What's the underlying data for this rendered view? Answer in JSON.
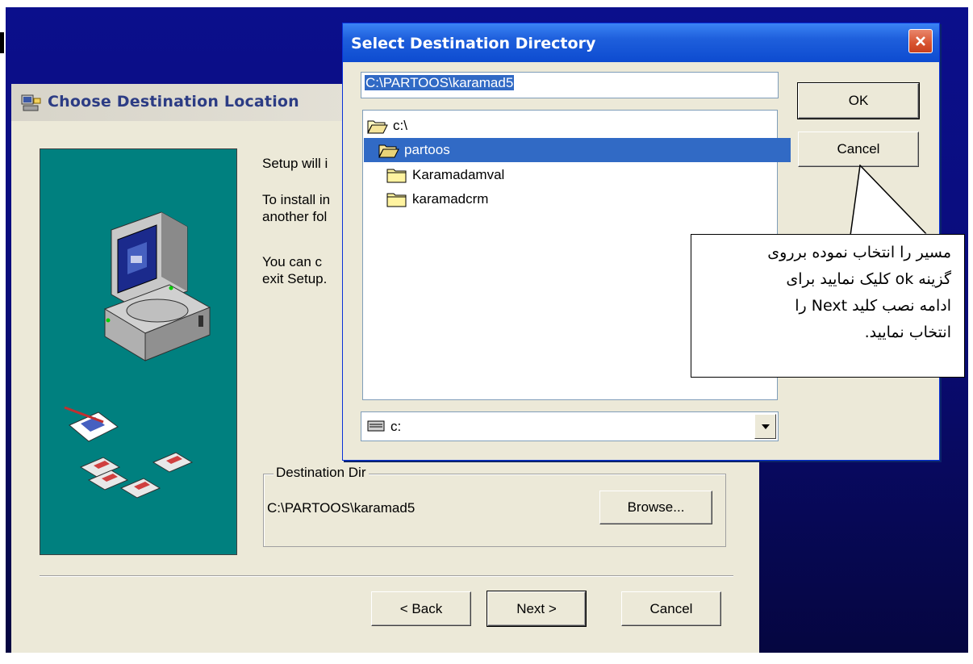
{
  "setup_window": {
    "title": "Choose Destination Location",
    "intro_line": "Setup will i",
    "para2_line1": "To install in",
    "para2_line2": "another fol",
    "para3_line1": "You can c",
    "para3_line2": "exit Setup.",
    "destination_group": {
      "label": "Destination Dir",
      "path": "C:\\PARTOOS\\karamad5",
      "browse_label": "Browse..."
    },
    "buttons": {
      "back": "< Back",
      "next": "Next >",
      "cancel": "Cancel"
    }
  },
  "select_dialog": {
    "title": "Select Destination Directory",
    "path_value": "C:\\PARTOOS\\karamad5",
    "ok_label": "OK",
    "cancel_label": "Cancel",
    "folders": [
      {
        "name": "c:\\",
        "state": "open"
      },
      {
        "name": "partoos",
        "state": "open-selected"
      },
      {
        "name": "Karamadamval",
        "state": "closed"
      },
      {
        "name": "karamadcrm",
        "state": "closed"
      }
    ],
    "drive": "c:"
  },
  "callout": {
    "line1": "مسیر را انتخاب نموده برروی",
    "line2": "گزینه ok کلیک نمایید برای",
    "line3": "ادامه نصب کلید Next را",
    "line4": "انتخاب نمایید."
  },
  "colors": {
    "desktop": "#0a0c7a",
    "panel_teal": "#00807f",
    "selection": "#316ac5",
    "xp_title": "#1e5fdc",
    "window_face": "#ece9d8"
  }
}
